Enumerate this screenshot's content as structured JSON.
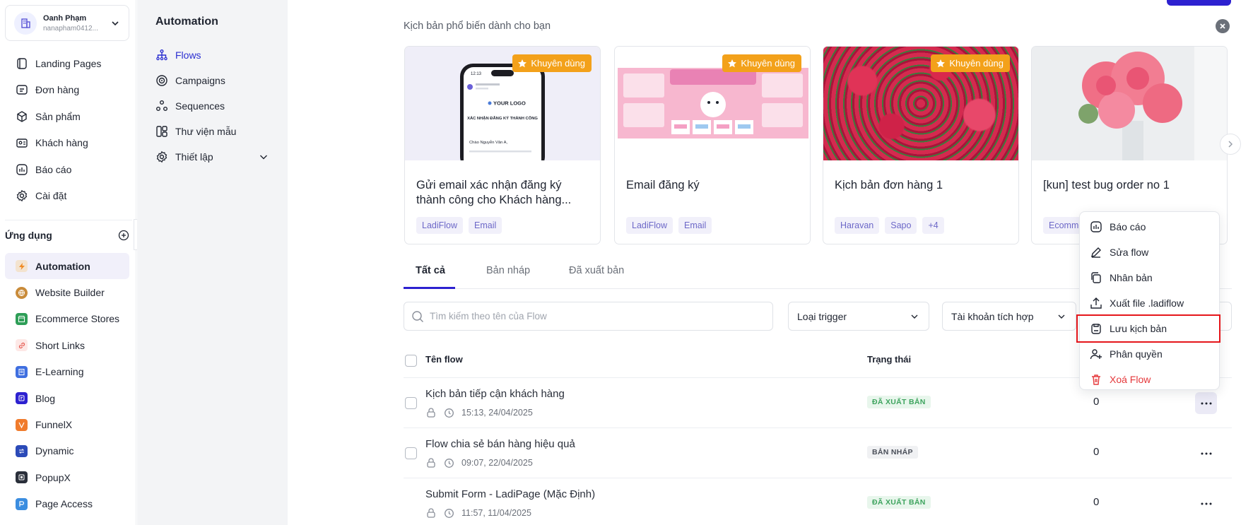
{
  "user": {
    "name": "Oanh Phạm",
    "email": "nanapham0412..."
  },
  "nav": [
    {
      "label": "Landing Pages",
      "icon": "landing-pages-icon"
    },
    {
      "label": "Đơn hàng",
      "icon": "orders-icon"
    },
    {
      "label": "Sản phẩm",
      "icon": "products-icon"
    },
    {
      "label": "Khách hàng",
      "icon": "customers-icon"
    },
    {
      "label": "Báo cáo",
      "icon": "reports-icon"
    },
    {
      "label": "Cài đặt",
      "icon": "settings-icon"
    }
  ],
  "apps": {
    "title": "Ứng dụng",
    "items": [
      {
        "label": "Automation",
        "color": "#f08a24",
        "active": true
      },
      {
        "label": "Website Builder",
        "color": "#c98b3a"
      },
      {
        "label": "Ecommerce Stores",
        "color": "#2e9e57"
      },
      {
        "label": "Short Links",
        "color": "#e5584f"
      },
      {
        "label": "E-Learning",
        "color": "#3f6fe0"
      },
      {
        "label": "Blog",
        "color": "#2d21d0"
      },
      {
        "label": "FunnelX",
        "color": "#f07b2c"
      },
      {
        "label": "Dynamic",
        "color": "#2b4ab8"
      },
      {
        "label": "PopupX",
        "color": "#2a2f3a"
      },
      {
        "label": "Page Access",
        "color": "#3b8de0"
      }
    ]
  },
  "module": {
    "title": "Automation",
    "items": [
      {
        "label": "Flows",
        "icon": "flows-icon",
        "active": true
      },
      {
        "label": "Campaigns",
        "icon": "campaigns-icon"
      },
      {
        "label": "Sequences",
        "icon": "sequences-icon"
      },
      {
        "label": "Thư viện mẫu",
        "icon": "template-library-icon"
      },
      {
        "label": "Thiết lập",
        "icon": "setup-icon",
        "chevron": true
      }
    ]
  },
  "suggest": {
    "title": "Kịch bản phổ biến dành cho bạn",
    "badge": "Khuyên dùng",
    "cards": [
      {
        "title": "Gửi email xác nhận đăng ký thành công cho Khách hàng...",
        "tags": [
          "LadiFlow",
          "Email"
        ],
        "recommended": true
      },
      {
        "title": "Email đăng ký",
        "tags": [
          "LadiFlow",
          "Email"
        ],
        "recommended": true
      },
      {
        "title": "Kịch bản đơn hàng 1",
        "tags": [
          "Haravan",
          "Sapo",
          "+4"
        ],
        "recommended": true
      },
      {
        "title": "[kun] test bug order no 1",
        "tags": [
          "Ecomme"
        ],
        "recommended": false
      }
    ],
    "phone_mock": {
      "time": "12:13",
      "logo": "YOUR LOGO",
      "heading": "XÁC NHẬN ĐĂNG KÝ THÀNH CÔNG",
      "greeting": "Chào Nguyễn Văn A,"
    }
  },
  "tabs": [
    "Tất cả",
    "Bản nháp",
    "Đã xuất bản"
  ],
  "filters": {
    "search_placeholder": "Tìm kiếm theo tên của Flow",
    "trigger": "Loại trigger",
    "account": "Tài khoản tích hợp"
  },
  "table": {
    "headers": {
      "name": "Tên flow",
      "status": "Trạng thái"
    },
    "rows": [
      {
        "name": "Kịch bản tiếp cận khách hàng",
        "time": "15:13, 24/04/2025",
        "status": "ĐÃ XUẤT BẢN",
        "status_type": "pub",
        "count": "0"
      },
      {
        "name": "Flow chia sẻ bán hàng hiệu quả",
        "time": "09:07, 22/04/2025",
        "status": "BẢN NHÁP",
        "status_type": "draft",
        "count": "0"
      },
      {
        "name": "Submit Form - LadiPage (Mặc Định)",
        "time": "11:57, 11/04/2025",
        "status": "ĐÃ XUẤT BẢN",
        "status_type": "pub",
        "count": "0"
      }
    ]
  },
  "context_menu": [
    {
      "label": "Báo cáo",
      "icon": "report-icon"
    },
    {
      "label": "Sửa flow",
      "icon": "edit-icon"
    },
    {
      "label": "Nhân bản",
      "icon": "duplicate-icon"
    },
    {
      "label": "Xuất file .ladiflow",
      "icon": "export-icon"
    },
    {
      "label": "Lưu kịch bản",
      "icon": "save-template-icon",
      "highlight": true
    },
    {
      "label": "Phân quyền",
      "icon": "permission-icon"
    },
    {
      "label": "Xoá Flow",
      "icon": "trash-icon",
      "danger": true
    }
  ]
}
